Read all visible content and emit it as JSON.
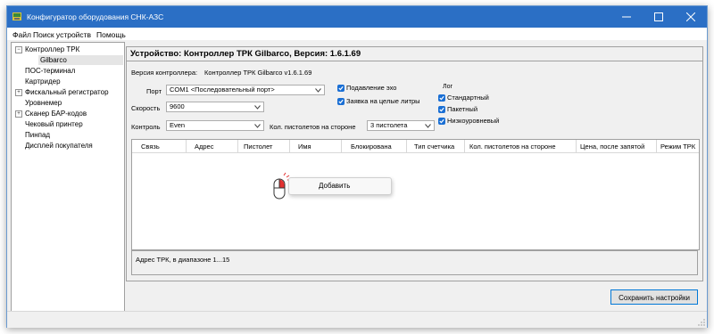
{
  "window": {
    "title": "Конфигуратор оборудования СНК-АЗС",
    "colors": {
      "titlebar": "#2b6fc5",
      "accent": "#1a6fd4"
    }
  },
  "menu": [
    "Файл",
    "Поиск устройств",
    "Помощь"
  ],
  "tree": [
    {
      "label": "Контроллер ТРК",
      "expander": "⊟"
    },
    {
      "label": "Gilbarco",
      "selected": true
    },
    {
      "label": "ПОС-терминал"
    },
    {
      "label": "Картридер"
    },
    {
      "label": "Фискальный регистратор",
      "expander": "⊞"
    },
    {
      "label": "Уровнемер"
    },
    {
      "label": "Сканер БАР-кодов",
      "expander": "⊞"
    },
    {
      "label": "Чековый принтер"
    },
    {
      "label": "Пинпад"
    },
    {
      "label": "Дисплей покупателя"
    }
  ],
  "panel": {
    "title": "Устройство: Контроллер ТРК Gilbarco, Версия: 1.6.1.69",
    "version_label": "Версия контроллера:",
    "version_value": "Контроллер ТРК Gilbarco v1.6.1.69",
    "port_label": "Порт",
    "port_value": "COM1 <Последовательный порт>",
    "speed_label": "Скорость",
    "speed_value": "9600",
    "control_label": "Контроль",
    "control_value": "Even",
    "nozzles_label": "Кол. пистолетов на стороне",
    "nozzles_value": "3 пистолета",
    "echo_label": "Подавление эхо",
    "echo_checked": true,
    "whole_liters_label": "Заявка на целые литры",
    "whole_liters_checked": true,
    "log": {
      "title": "Лог",
      "standard_label": "Стандартный",
      "standard_checked": true,
      "packet_label": "Пакетный",
      "packet_checked": true,
      "lowlevel_label": "Низкоуровневый",
      "lowlevel_checked": true
    }
  },
  "grid": {
    "columns": [
      "Связь",
      "Адрес",
      "Пистолет",
      "Имя",
      "Блокирована",
      "Тип счетчика",
      "Кол. пистолетов на стороне",
      "Цена, после запятой",
      "Режим ТРК"
    ],
    "rows": []
  },
  "hint": "Адрес ТРК, в диапазоне 1...15",
  "context_menu": {
    "add_label": "Добавить"
  },
  "footer": {
    "save_label": "Сохранить настройки"
  }
}
